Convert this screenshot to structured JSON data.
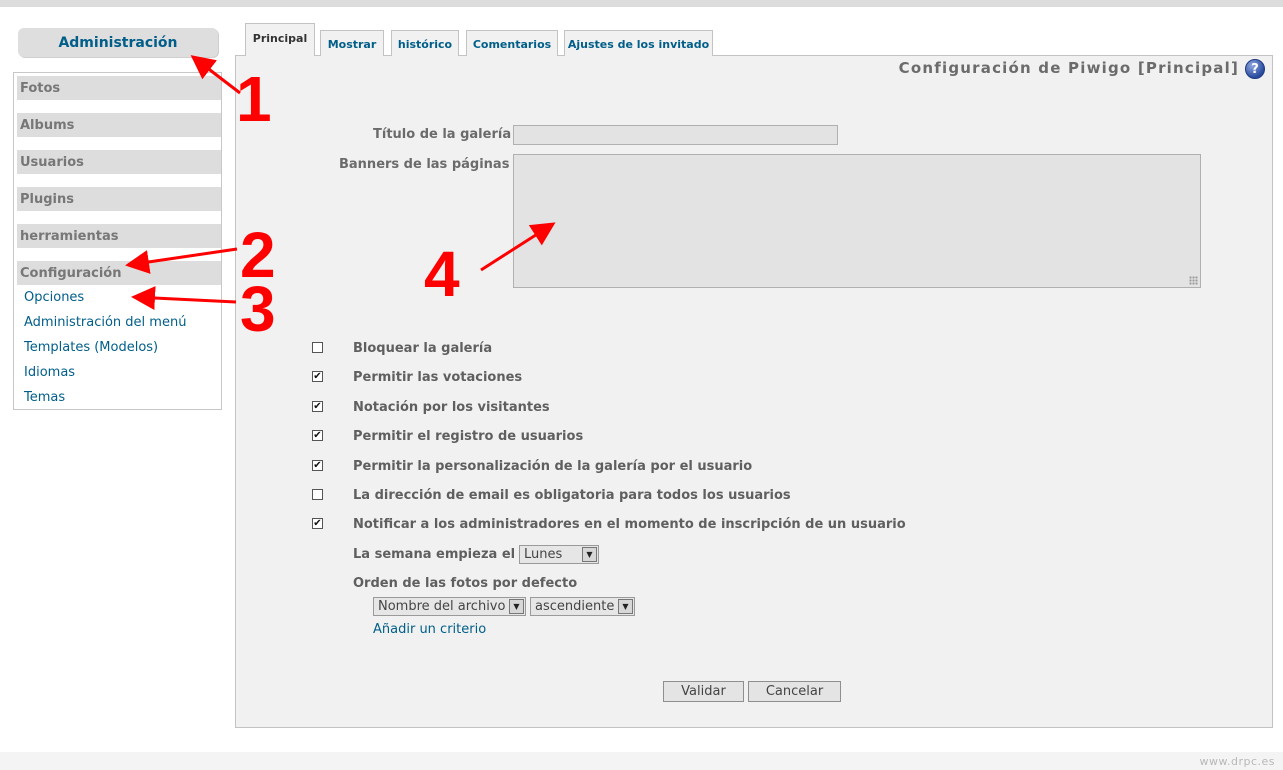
{
  "sidebar": {
    "title": "Administración",
    "sections": [
      "Fotos",
      "Albums",
      "Usuarios",
      "Plugins",
      "herramientas",
      "Configuración"
    ],
    "config_links": [
      "Opciones",
      "Administración del menú",
      "Templates (Modelos)",
      "Idiomas",
      "Temas"
    ]
  },
  "tabs": [
    "Principal",
    "Mostrar",
    "histórico",
    "Comentarios",
    "Ajustes de los invitado"
  ],
  "active_tab": "Principal",
  "header": {
    "title": "Configuración de Piwigo [Principal]",
    "help_icon": "?"
  },
  "form": {
    "gallery_title_label": "Título de la galería",
    "gallery_title_value": "",
    "banner_label": "Banners de las páginas",
    "banner_value": "",
    "options": [
      {
        "label": "Bloquear la galería",
        "checked": false
      },
      {
        "label": "Permitir las votaciones",
        "checked": true
      },
      {
        "label": "Notación por los visitantes",
        "checked": true
      },
      {
        "label": "Permitir el registro de usuarios",
        "checked": true
      },
      {
        "label": "Permitir la personalización de la galería por el usuario",
        "checked": true
      },
      {
        "label": "La dirección de email es obligatoria para todos los usuarios",
        "checked": false
      },
      {
        "label": "Notificar a los administradores en el momento de inscripción de un usuario",
        "checked": true
      }
    ],
    "week_start_label": "La semana empieza el",
    "week_start_value": "Lunes",
    "sort_label": "Orden de las fotos por defecto",
    "sort_field_value": "Nombre del archivo",
    "sort_direction_value": "ascendiente",
    "add_criteria_link": "Añadir un criterio",
    "submit_label": "Validar",
    "cancel_label": "Cancelar"
  },
  "annotations": [
    "1",
    "2",
    "3",
    "4"
  ],
  "annotation_color": "#ff0000",
  "link_color": "#005e89",
  "watermark": "www.drpc.es"
}
